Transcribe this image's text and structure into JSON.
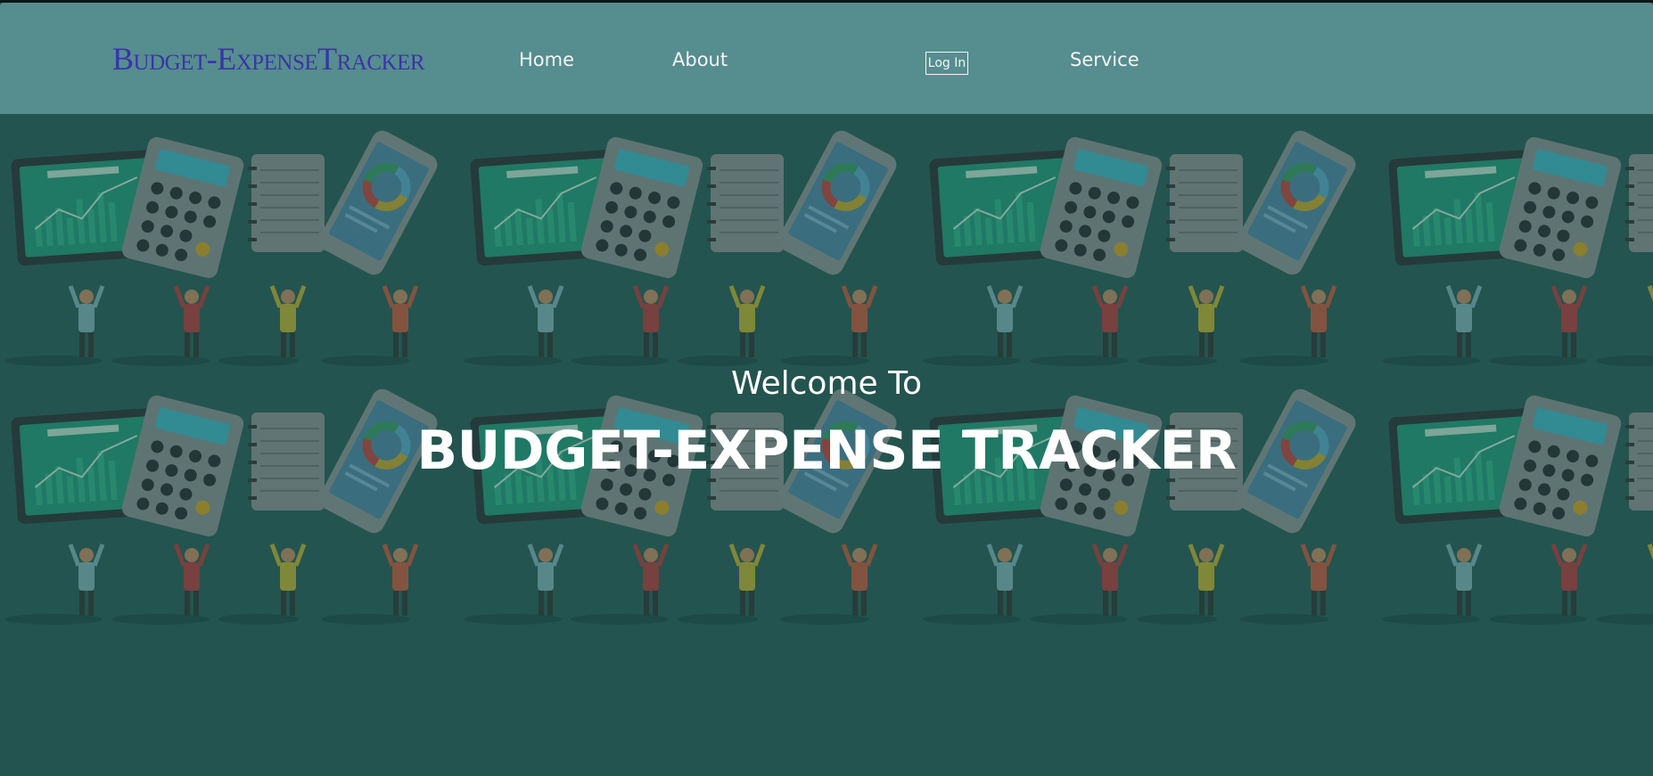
{
  "navbar": {
    "brand": "Budget-ExpenseTracker",
    "links": {
      "home": "Home",
      "about": "About",
      "login": "Log In",
      "service": "Service"
    }
  },
  "hero": {
    "welcome": "Welcome To",
    "title": "BUDGET-EXPENSE TRACKER"
  },
  "background": {
    "illustration_items": [
      "tablet-chart-icon",
      "calculator-icon",
      "notebook-icon",
      "smartphone-pie-chart-icon",
      "person-figure-icon"
    ]
  },
  "colors": {
    "navbar": "#568d8f",
    "page_background": "#265a55",
    "brand": "#3a34a8",
    "text": "#ffffff"
  }
}
